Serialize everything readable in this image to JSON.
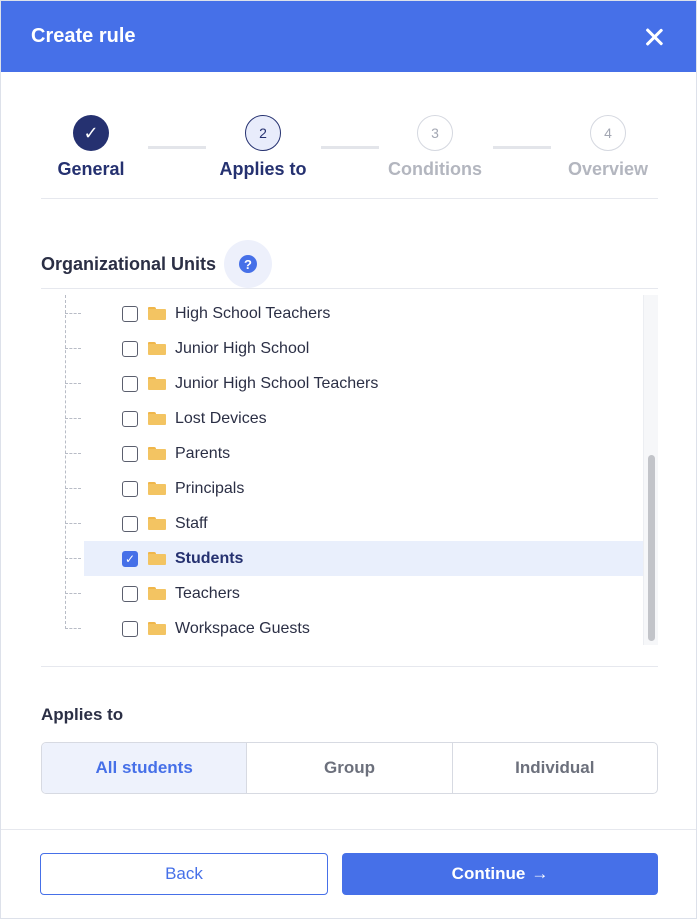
{
  "dialog": {
    "title": "Create rule",
    "close_icon": "close-icon"
  },
  "stepper": {
    "steps": [
      {
        "label": "General",
        "marker": "✓",
        "state": "done"
      },
      {
        "label": "Applies to",
        "marker": "2",
        "state": "current"
      },
      {
        "label": "Conditions",
        "marker": "3",
        "state": "todo"
      },
      {
        "label": "Overview",
        "marker": "4",
        "state": "todo"
      }
    ]
  },
  "org_units": {
    "title": "Organizational Units",
    "help_icon": "?",
    "items": [
      {
        "label": "High School Teachers",
        "checked": false
      },
      {
        "label": "Junior High School",
        "checked": false
      },
      {
        "label": "Junior High School Teachers",
        "checked": false
      },
      {
        "label": "Lost Devices",
        "checked": false
      },
      {
        "label": "Parents",
        "checked": false
      },
      {
        "label": "Principals",
        "checked": false
      },
      {
        "label": "Staff",
        "checked": false
      },
      {
        "label": "Students",
        "checked": true,
        "check_mark": "✓"
      },
      {
        "label": "Teachers",
        "checked": false
      },
      {
        "label": "Workspace Guests",
        "checked": false
      }
    ]
  },
  "applies_to": {
    "title": "Applies to",
    "options": [
      "All students",
      "Group",
      "Individual"
    ],
    "selected": "All students"
  },
  "footer": {
    "back_label": "Back",
    "continue_label": "Continue",
    "continue_arrow": "→"
  },
  "colors": {
    "accent": "#4670e8",
    "dark_navy": "#253170",
    "folder": "#f3c462"
  }
}
